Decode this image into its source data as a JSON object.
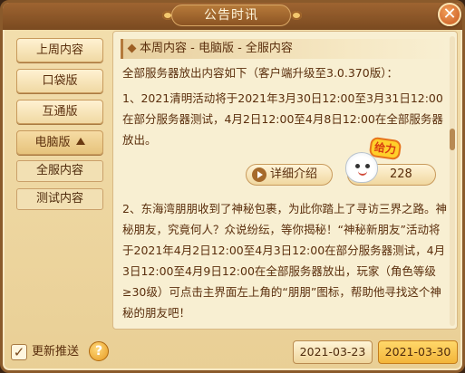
{
  "window": {
    "title": "公告时讯",
    "close_glyph": "✕"
  },
  "sidebar": {
    "items": [
      {
        "label": "上周内容"
      },
      {
        "label": "口袋版"
      },
      {
        "label": "互通版"
      },
      {
        "label": "电脑版"
      }
    ],
    "subitems": [
      {
        "label": "全服内容"
      },
      {
        "label": "测试内容"
      }
    ]
  },
  "content": {
    "section_title": "本周内容 - 电脑版 - 全服内容",
    "intro": "全部服务器放出内容如下（客户端升级至3.0.370版）：",
    "item1": "1、2021清明活动将于2021年3月30日12:00至3月31日12:00在部分服务器测试，4月2日12:00至4月8日12:00在全部服务器放出。",
    "detail_button": "详细介绍",
    "like_count": "228",
    "badge": "给力",
    "item2": "2、东海湾朋朋收到了神秘包裹，为此你踏上了寻访三界之路。神秘朋友，究竟何人？众说纷纭，等你揭秘！“神秘新朋友”活动将于2021年4月2日12:00至4月3日12:00在部分服务器测试，4月3日12:00至4月9日12:00在全部服务器放出，玩家（角色等级≥30级）可点击主界面左上角的“朋朋”图标，帮助他寻找这个神秘的朋友吧！"
  },
  "footer": {
    "checkbox_label": "更新推送",
    "checkbox_glyph": "✓",
    "help_glyph": "?",
    "dates": [
      "2021-03-23",
      "2021-03-30"
    ]
  }
}
